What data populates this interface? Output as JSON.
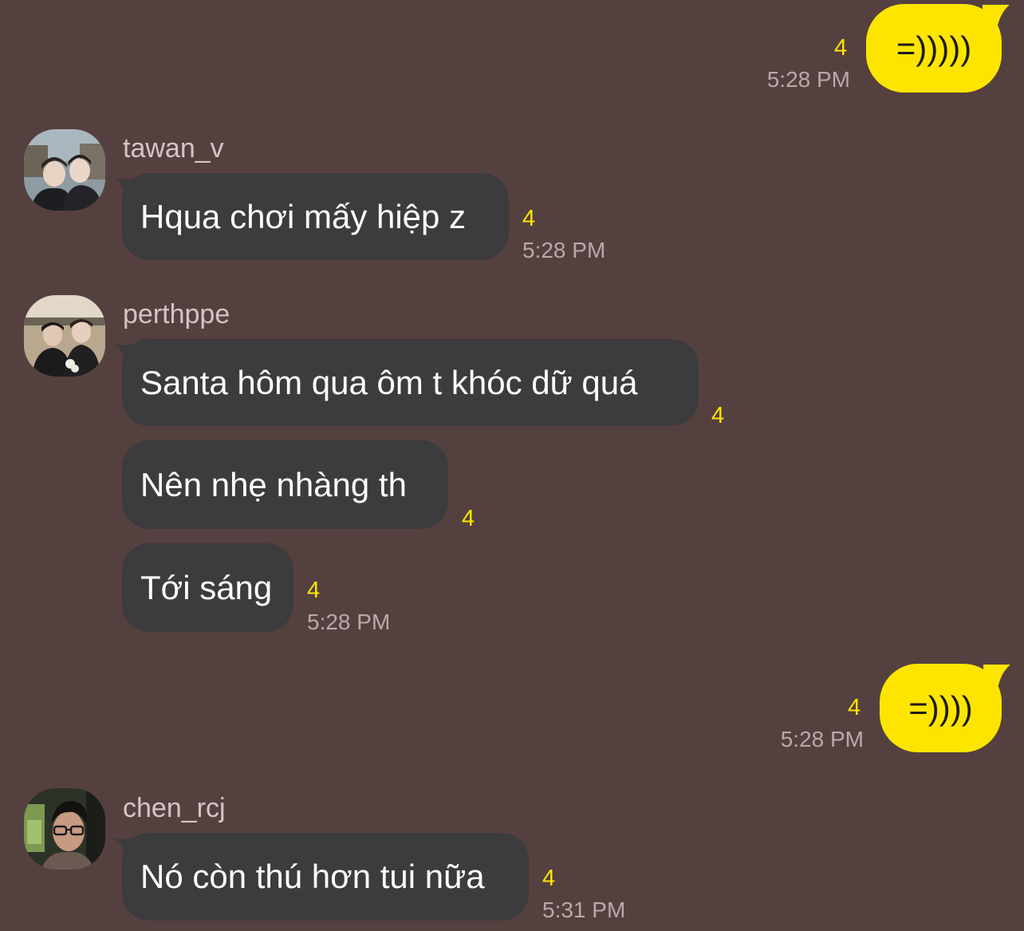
{
  "messages": {
    "m1": {
      "text": "=)))))",
      "unread": "4",
      "time": "5:28 PM"
    },
    "m2": {
      "sender": "tawan_v",
      "text": "Hqua chơi mấy hiệp z",
      "unread": "4",
      "time": "5:28 PM"
    },
    "m3": {
      "sender": "perthppe",
      "text": "Santa hôm qua ôm t khóc dữ quá",
      "unread": "4"
    },
    "m4": {
      "text": "Nên nhẹ nhàng th",
      "unread": "4"
    },
    "m5": {
      "text": "Tới sáng",
      "unread": "4",
      "time": "5:28 PM"
    },
    "m6": {
      "text": "=))))",
      "unread": "4",
      "time": "5:28 PM"
    },
    "m7": {
      "sender": "chen_rcj",
      "text": "Nó còn thú hơn tui nữa",
      "unread": "4",
      "time": "5:31 PM"
    }
  },
  "colors": {
    "background": "#554040",
    "incoming_bubble": "#3c3b3d",
    "outgoing_bubble": "#fee500",
    "unread_count": "#fee500",
    "timestamp": "#b6aaa9"
  }
}
